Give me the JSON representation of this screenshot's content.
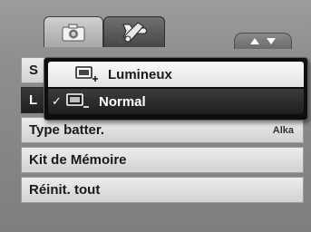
{
  "tabs": [
    {
      "icon": "camera-icon",
      "active": false
    },
    {
      "icon": "wrench-icon",
      "active": true
    }
  ],
  "menu": {
    "items": [
      {
        "label": "S",
        "value": ""
      },
      {
        "label": "L",
        "value": ""
      },
      {
        "label": "Type batter.",
        "value": "Alka"
      },
      {
        "label": "Kit de Mémoire",
        "value": ""
      },
      {
        "label": "Réinit. tout",
        "value": ""
      }
    ]
  },
  "popup": {
    "options": [
      {
        "label": "Lumineux",
        "icon": "brightness-plus-icon",
        "selected": false
      },
      {
        "label": "Normal",
        "icon": "brightness-minus-icon",
        "selected": true
      }
    ],
    "check_mark": "✓"
  },
  "colors": {
    "background": "#8e8e8e",
    "highlight_row": "#2a2a2a",
    "normal_row": "#e0e0e0"
  }
}
